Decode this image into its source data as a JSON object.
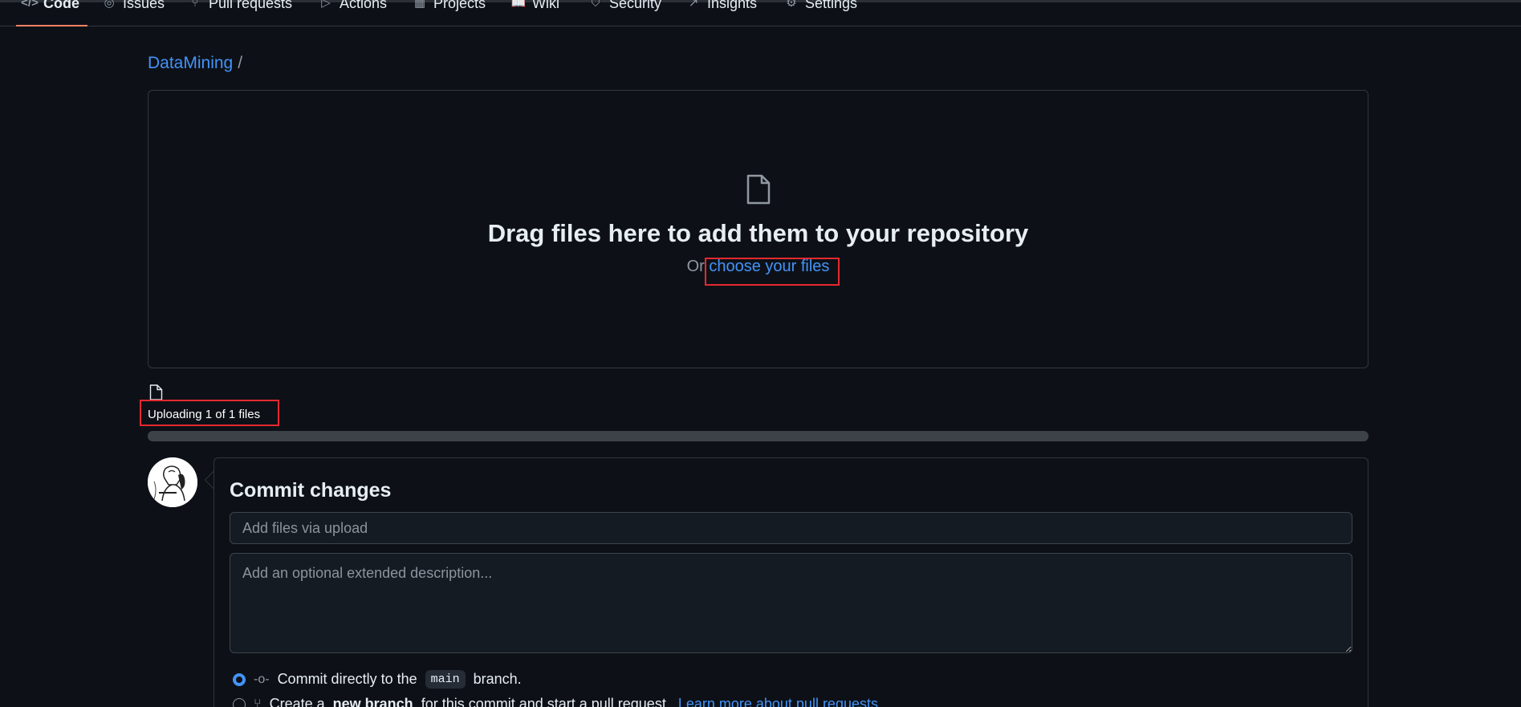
{
  "nav": {
    "tabs": [
      {
        "label": "Code",
        "icon": "code-icon"
      },
      {
        "label": "Issues",
        "icon": "issue-icon"
      },
      {
        "label": "Pull requests",
        "icon": "pull-request-icon"
      },
      {
        "label": "Actions",
        "icon": "play-icon"
      },
      {
        "label": "Projects",
        "icon": "table-icon"
      },
      {
        "label": "Wiki",
        "icon": "book-icon"
      },
      {
        "label": "Security",
        "icon": "shield-icon"
      },
      {
        "label": "Insights",
        "icon": "graph-icon"
      },
      {
        "label": "Settings",
        "icon": "gear-icon"
      }
    ],
    "active_tab": "Code"
  },
  "breadcrumb": {
    "owner": "DataMining",
    "separator": "/"
  },
  "dropzone": {
    "title": "Drag files here to add them to your repository",
    "prefix": "Or",
    "link": "choose your files"
  },
  "upload": {
    "status": "Uploading 1 of 1 files",
    "progress_percent": 100
  },
  "commit": {
    "title": "Commit changes",
    "summary_placeholder": "Add files via upload",
    "description_placeholder": "Add an optional extended description...",
    "option_direct": {
      "prefix": "Commit directly to the",
      "branch": "main",
      "suffix": "branch."
    },
    "option_new": {
      "prefix": "Create a",
      "bold": "new branch",
      "middle": "for this commit and start a pull request.",
      "link": "Learn more about pull requests."
    }
  },
  "colors": {
    "accent": "#4493f8",
    "active_tab": "#f78166",
    "highlight": "#e5292f",
    "background": "#0d1117"
  }
}
